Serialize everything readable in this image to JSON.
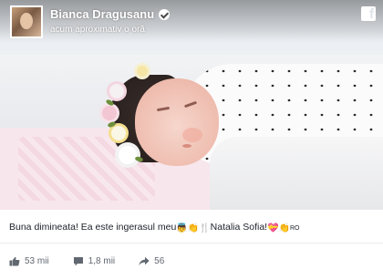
{
  "post": {
    "author": "Bianca Dragusanu",
    "timestamp": "acum aproximativ o oră",
    "caption": {
      "text": "Buna dimineata! Ea este ingerasul meu",
      "emojis_1": [
        "👼",
        "👏",
        "🍴"
      ],
      "name": "Natalia Sofia!",
      "emojis_2": [
        "💝",
        "👏"
      ],
      "suffix": "RO"
    }
  },
  "stats": {
    "likes": "53 mii",
    "comments": "1,8 mii",
    "shares": "56"
  },
  "icons": {
    "verified": "verified-badge-icon",
    "facebook": "facebook-logo-icon",
    "like": "thumbs-up-icon",
    "comment": "speech-bubble-icon",
    "share": "share-arrow-icon"
  },
  "colors": {
    "text": "#1d2129",
    "muted": "#606770"
  }
}
